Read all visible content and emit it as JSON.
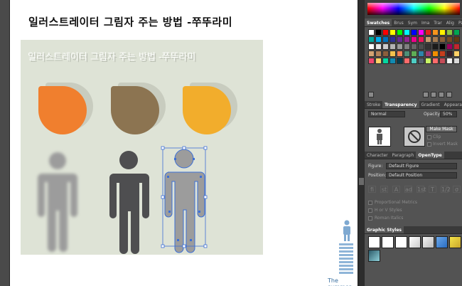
{
  "document": {
    "title": "일러스트레이터 그림자 주는 방법 -쭈뚜라미",
    "artwork_text": "일러스트레이터 그림자 주는 방법 -쭈뚜라미",
    "caption": "The summer"
  },
  "colors": {
    "leaf_orange": "#f07f2e",
    "leaf_brown": "#8c7451",
    "leaf_yellow": "#f2ad2c",
    "figure_dark": "#4e4e50",
    "figure_grey": "#9c9c9c",
    "selection_blue": "#3c6fd6",
    "artwork_bg": "#dee3d6"
  },
  "panels": {
    "swatches": {
      "tabs": [
        "Swatches",
        "Brus",
        "Sym",
        "Ima",
        "Trar",
        "Alig",
        "Path"
      ],
      "active_tab": 0
    },
    "transparency": {
      "tabs": [
        "Stroke",
        "Transparency",
        "Gradient",
        "Appeara"
      ],
      "active_tab": 1,
      "blend_mode": "Normal",
      "opacity_label": "Opacity:",
      "opacity_value": "50%",
      "make_mask": "Make Mask",
      "clip": "Clip",
      "invert_mask": "Invert Mask"
    },
    "opentype": {
      "tabs": [
        "Character",
        "Paragraph",
        "OpenType"
      ],
      "active_tab": 2,
      "figure_label": "Figure:",
      "figure_value": "Default Figure",
      "position_label": "Position:",
      "position_value": "Default Position",
      "glyph_icons": [
        "fi",
        "st",
        "A",
        "ad",
        "1st",
        "T",
        "1/2",
        "σ"
      ],
      "options": [
        "Proportional Metrics",
        "H or V Styles",
        "Roman Italics"
      ]
    },
    "graphic_styles": {
      "tabs": [
        "Graphic Styles"
      ],
      "active_tab": 0
    }
  }
}
